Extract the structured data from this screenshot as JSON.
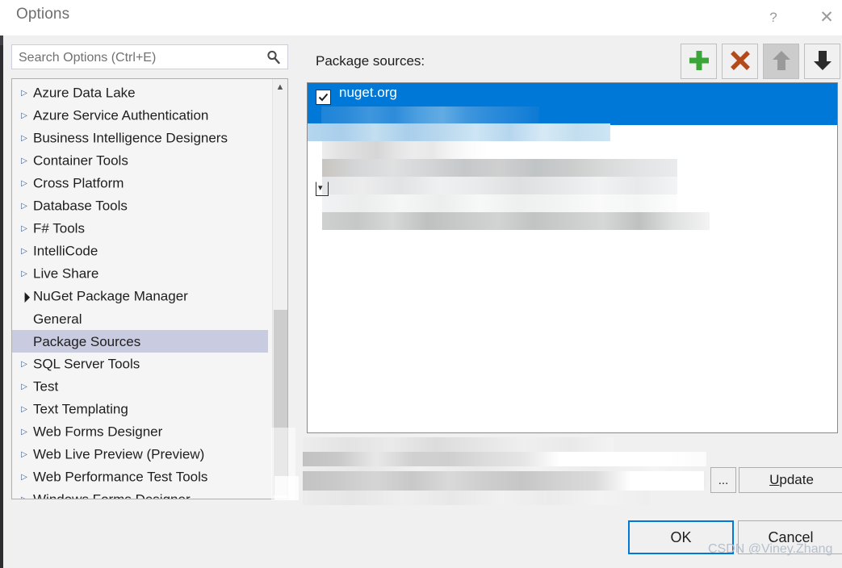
{
  "window": {
    "title": "Options",
    "help_icon": "question-mark-icon",
    "close_icon": "close-icon"
  },
  "search": {
    "placeholder": "Search Options (Ctrl+E)",
    "value": "",
    "icon": "search-icon"
  },
  "tree": {
    "items": [
      {
        "label": "Azure Data Lake",
        "state": "collapsed",
        "level": 0,
        "selected": false
      },
      {
        "label": "Azure Service Authentication",
        "state": "collapsed",
        "level": 0,
        "selected": false
      },
      {
        "label": "Business Intelligence Designers",
        "state": "collapsed",
        "level": 0,
        "selected": false
      },
      {
        "label": "Container Tools",
        "state": "collapsed",
        "level": 0,
        "selected": false
      },
      {
        "label": "Cross Platform",
        "state": "collapsed",
        "level": 0,
        "selected": false
      },
      {
        "label": "Database Tools",
        "state": "collapsed",
        "level": 0,
        "selected": false
      },
      {
        "label": "F# Tools",
        "state": "collapsed",
        "level": 0,
        "selected": false
      },
      {
        "label": "IntelliCode",
        "state": "collapsed",
        "level": 0,
        "selected": false
      },
      {
        "label": "Live Share",
        "state": "collapsed",
        "level": 0,
        "selected": false
      },
      {
        "label": "NuGet Package Manager",
        "state": "expanded",
        "level": 0,
        "selected": false
      },
      {
        "label": "General",
        "state": "leaf",
        "level": 1,
        "selected": false
      },
      {
        "label": "Package Sources",
        "state": "leaf",
        "level": 1,
        "selected": true
      },
      {
        "label": "SQL Server Tools",
        "state": "collapsed",
        "level": 0,
        "selected": false
      },
      {
        "label": "Test",
        "state": "collapsed",
        "level": 0,
        "selected": false
      },
      {
        "label": "Text Templating",
        "state": "collapsed",
        "level": 0,
        "selected": false
      },
      {
        "label": "Web Forms Designer",
        "state": "collapsed",
        "level": 0,
        "selected": false
      },
      {
        "label": "Web Live Preview (Preview)",
        "state": "collapsed",
        "level": 0,
        "selected": false
      },
      {
        "label": "Web Performance Test Tools",
        "state": "collapsed",
        "level": 0,
        "selected": false
      },
      {
        "label": "Windows Forms Designer",
        "state": "collapsed",
        "level": 0,
        "selected": false
      }
    ],
    "scrollbar": {
      "up_icon": "chevron-up-icon"
    }
  },
  "package_sources": {
    "label": "Package sources:",
    "toolbar": {
      "add_icon": "plus-icon",
      "remove_icon": "x-icon",
      "move_up_icon": "arrow-up-icon",
      "move_down_icon": "arrow-down-icon"
    },
    "rows": [
      {
        "name": "nuget.org",
        "checked": true,
        "selected": true
      }
    ]
  },
  "bottom": {
    "browse_label": "...",
    "update_label_prefix": "",
    "update_accel": "U",
    "update_label_rest": "pdate"
  },
  "footer": {
    "ok_label": "OK",
    "cancel_label": "Cancel"
  },
  "watermark": {
    "text": "CSDN @Viney.Zhang"
  },
  "colors": {
    "selection_blue": "#0078d7",
    "tree_selection": "#c9cbe0",
    "accent_border": "#0078d7",
    "add_green": "#3aa63a",
    "remove_red": "#b34a1a",
    "dialog_bg": "#f0f0f0"
  }
}
